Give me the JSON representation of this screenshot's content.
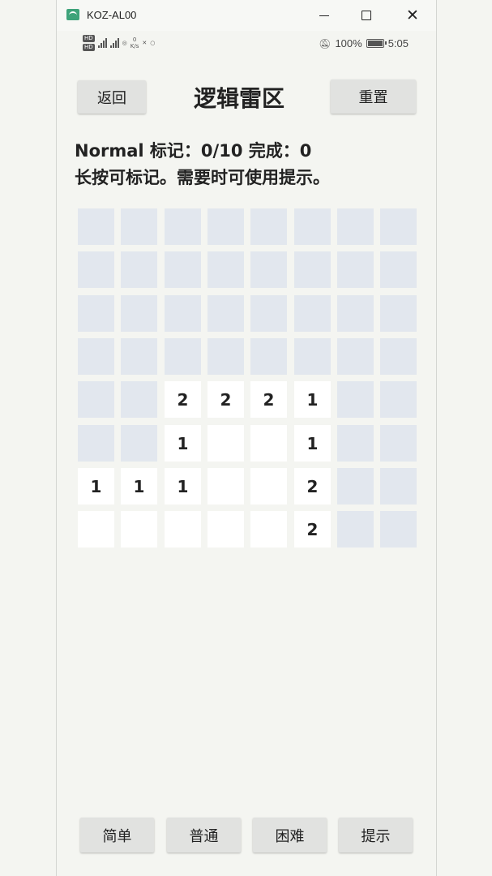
{
  "window": {
    "title": "KOZ-AL00"
  },
  "statusbar": {
    "net_speed_top": "0",
    "net_speed_unit": "K/s",
    "battery": "100%",
    "time": "5:05"
  },
  "header": {
    "back_label": "返回",
    "title": "逻辑雷区",
    "reset_label": "重置"
  },
  "info": {
    "status_line": "Normal 标记：0/10 完成：0",
    "hint_line": "长按可标记。需要时可使用提示。"
  },
  "board": {
    "rows": [
      [
        "#",
        "#",
        "#",
        "#",
        "#",
        "#",
        "#",
        "#"
      ],
      [
        "#",
        "#",
        "#",
        "#",
        "#",
        "#",
        "#",
        "#"
      ],
      [
        "#",
        "#",
        "#",
        "#",
        "#",
        "#",
        "#",
        "#"
      ],
      [
        "#",
        "#",
        "#",
        "#",
        "#",
        "#",
        "#",
        "#"
      ],
      [
        "#",
        "#",
        "2",
        "2",
        "2",
        "1",
        "#",
        "#"
      ],
      [
        "#",
        "#",
        "1",
        "",
        "",
        "1",
        "#",
        "#"
      ],
      [
        "1",
        "1",
        "1",
        "",
        "",
        "2",
        "#",
        "#"
      ],
      [
        "",
        "",
        "",
        "",
        "",
        "2",
        "#",
        "#"
      ]
    ]
  },
  "footer": {
    "easy_label": "简单",
    "normal_label": "普通",
    "hard_label": "困难",
    "hint_label": "提示"
  },
  "colors": {
    "background": "#f4f5f1",
    "hidden_cell": "#e2e7ee",
    "open_cell": "#ffffff",
    "button": "#e1e2e0"
  }
}
